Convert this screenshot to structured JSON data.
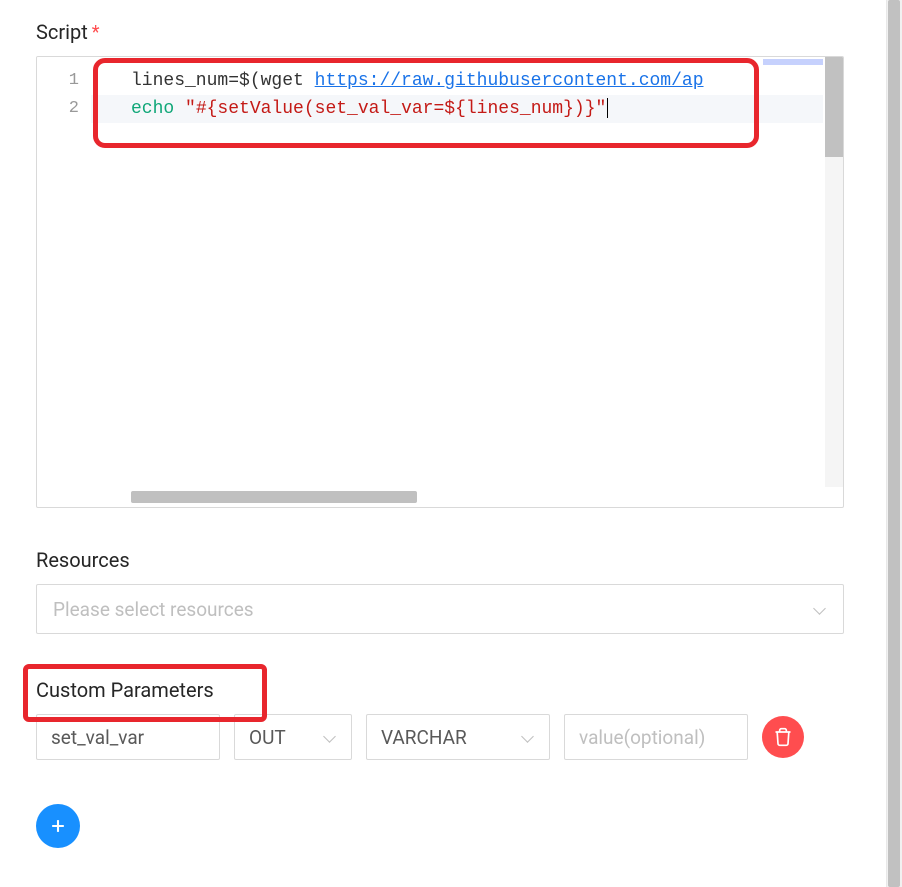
{
  "script": {
    "label": "Script",
    "required_marker": "*",
    "lines": [
      {
        "num": "1",
        "segments": [
          {
            "cls": "tok-plain",
            "text": "lines_num=$(wget "
          },
          {
            "cls": "tok-url",
            "text": "https://raw.githubusercontent.com/ap"
          }
        ]
      },
      {
        "num": "2",
        "segments": [
          {
            "cls": "tok-keyword",
            "text": "echo"
          },
          {
            "cls": "tok-plain",
            "text": " "
          },
          {
            "cls": "tok-string",
            "text": "\"#{setValue(set_val_var=${lines_num})}\""
          }
        ]
      }
    ]
  },
  "resources": {
    "label": "Resources",
    "placeholder": "Please select resources"
  },
  "custom_params": {
    "label": "Custom Parameters",
    "rows": [
      {
        "name": "set_val_var",
        "direction": "OUT",
        "type": "VARCHAR",
        "value_placeholder": "value(optional)"
      }
    ]
  },
  "icons": {
    "add": "plus-icon",
    "delete": "trash-icon",
    "chevron": "chevron-down-icon"
  }
}
